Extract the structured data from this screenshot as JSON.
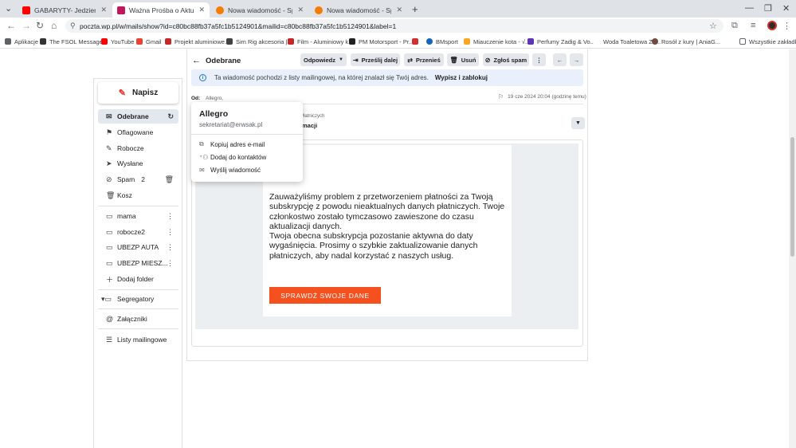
{
  "browser": {
    "tabs": [
      {
        "title": "GABARYTY- Jedziemy do SZWE",
        "favicon_color": "#ff0000"
      },
      {
        "title": "Ważna Prośba o Aktualizację Tre",
        "favicon_color": "#c2185b"
      },
      {
        "title": "Nowa wiadomość - Społeczność",
        "favicon_color": "#f57c00"
      },
      {
        "title": "Nowa wiadomość - Społeczność",
        "favicon_color": "#f57c00"
      }
    ],
    "new_tab": "+",
    "url": "poczta.wp.pl/w/mails/show?id=c80bc88fb37a5fc1b5124901&mailid=c80bc88fb37a5fc1b5124901&label=1",
    "bookmarks": [
      {
        "label": "Aplikacje",
        "icon": "apps-icon",
        "color": "#5f6368"
      },
      {
        "label": "The FSOL Message...",
        "icon": "fsol-icon",
        "color": "#333333"
      },
      {
        "label": "YouTube",
        "icon": "youtube-icon",
        "color": "#ff0000"
      },
      {
        "label": "Gmail",
        "icon": "gmail-icon",
        "color": "#ea4335"
      },
      {
        "label": "Projekt aluminiowe...",
        "icon": "projekt-icon",
        "color": "#c62828"
      },
      {
        "label": "Sim Rig akcesoria |...",
        "icon": "simrig-icon",
        "color": "#424242"
      },
      {
        "label": "Film - Aluminiowy k...",
        "icon": "film-icon",
        "color": "#c62828"
      },
      {
        "label": "PM Motorsport - Pr...",
        "icon": "pm-icon",
        "color": "#212121"
      },
      {
        "label": "",
        "icon": "flag-icon",
        "color": "#d32f2f"
      },
      {
        "label": "BMsport",
        "icon": "bmsport-icon",
        "color": "#1565c0"
      },
      {
        "label": "Miauczenie kota - √...",
        "icon": "miau-icon",
        "color": "#f9a825"
      },
      {
        "label": "Perfumy Zadig & Vo...",
        "icon": "perfumy-icon",
        "color": "#5e35b1"
      },
      {
        "label": "Woda Toaletowa Za...",
        "icon": "woda-icon",
        "color": "#9e9e9e"
      },
      {
        "label": "Rosół z kury | AniaG...",
        "icon": "rosol-icon",
        "color": "#6d4c41"
      }
    ],
    "all_bookmarks": "Wszystkie zakładki"
  },
  "sidebar": {
    "compose_label": "Napisz",
    "folders": [
      {
        "label": "Odebrane",
        "icon": "inbox-icon",
        "glyph": "✉",
        "active": true,
        "right": "↻"
      },
      {
        "label": "Oflagowane",
        "icon": "flag-icon",
        "glyph": "⚑"
      },
      {
        "label": "Robocze",
        "icon": "draft-icon",
        "glyph": "✎"
      },
      {
        "label": "Wysłane",
        "icon": "send-icon",
        "glyph": "➤"
      },
      {
        "label": "Spam",
        "icon": "spam-icon",
        "glyph": "⊘",
        "count": "2",
        "right": "🗑"
      },
      {
        "label": "Kosz",
        "icon": "trash-icon",
        "glyph": "🗑"
      }
    ],
    "user_folders": [
      {
        "label": "mama",
        "icon": "folder-icon",
        "glyph": "▭"
      },
      {
        "label": "robocze2",
        "icon": "folder-icon",
        "glyph": "▭"
      },
      {
        "label": "UBEZP AUTA",
        "icon": "folder-icon",
        "glyph": "▭"
      },
      {
        "label": "UBEZP MIESZ...",
        "icon": "folder-icon",
        "glyph": "▭"
      }
    ],
    "add_folder": "Dodaj folder",
    "extras": [
      {
        "label": "Segregatory",
        "icon": "segregatory-icon",
        "glyph": "▾▭"
      },
      {
        "label": "Załączniki",
        "icon": "attachment-icon",
        "glyph": "@"
      },
      {
        "label": "Listy mailingowe",
        "icon": "list-icon",
        "glyph": "☰"
      }
    ]
  },
  "toolbar": {
    "back_label": "Odebrane",
    "reply": "Odpowiedz",
    "forward": "Prześlij dalej",
    "move": "Przenieś",
    "delete": "Usuń",
    "report_spam": "Zgłoś spam"
  },
  "infobar": {
    "text": "Ta wiadomość pochodzi z listy mailingowej, na której znalazł się Twój adres.",
    "link": "Wypisz i zablokuj"
  },
  "message": {
    "from_label": "Od:",
    "from_name": "Allegro,",
    "date": "19 cze 2024 20:04 (godzinę temu)",
    "subject_tail": "ch Płatniczych",
    "subject_tail2": "formacji",
    "body": "Zauważyliśmy problem z przetworzeniem płatności za Twoją subskrypcję z powodu nieaktualnych danych płatniczych. Twoje członkostwo zostało tymczasowo zawieszone do czasu aktualizacji danych.\nTwoja obecna subskrypcja pozostanie aktywna do daty wygaśnięcia. Prosimy o szybkie zaktualizowanie danych płatniczych, aby nadal korzystać z naszych usług.",
    "cta": "SPRAWDŹ SWOJE DANE"
  },
  "popup": {
    "name": "Allegro",
    "email": "sekretariat@erwsak.pl",
    "items": [
      {
        "label": "Kopiuj adres e-mail",
        "icon": "copy-icon",
        "glyph": "⧉"
      },
      {
        "label": "Dodaj do kontaktów",
        "icon": "add-contact-icon",
        "glyph": "⁺⚇"
      },
      {
        "label": "Wyślij wiadomość",
        "icon": "mail-icon",
        "glyph": "✉"
      }
    ]
  },
  "colors": {
    "accent": "#f4511e",
    "compose_pen": "#e53935",
    "info_bg": "#e9f0fb"
  }
}
